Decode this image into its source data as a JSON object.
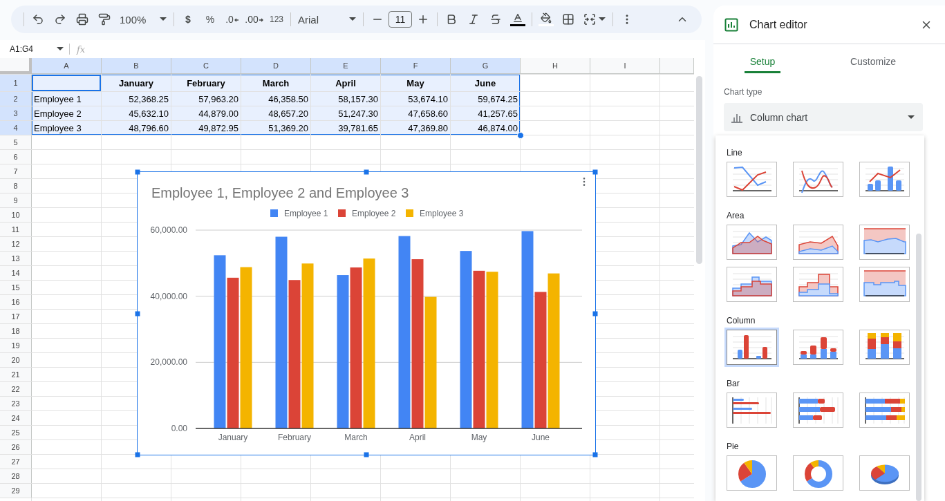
{
  "toolbar": {
    "zoom": "100%",
    "format_buttons": [
      {
        "kind": "currency",
        "label": "$"
      },
      {
        "kind": "percent",
        "label": "%"
      },
      {
        "kind": "decrease-decimal",
        "label": ".0"
      },
      {
        "kind": "increase-decimal",
        "label": ".00"
      },
      {
        "kind": "number-format",
        "label": "123"
      }
    ],
    "font": "Arial",
    "font_size": "11"
  },
  "formula_bar": {
    "name_box": "A1:G4",
    "function_label": "fx"
  },
  "sheet": {
    "columns": [
      {
        "label": "A",
        "selected": true
      },
      {
        "label": "B",
        "selected": true
      },
      {
        "label": "C",
        "selected": true
      },
      {
        "label": "D",
        "selected": true
      },
      {
        "label": "E",
        "selected": true
      },
      {
        "label": "F",
        "selected": true
      },
      {
        "label": "G",
        "selected": true
      },
      {
        "label": "H",
        "selected": false
      },
      {
        "label": "I",
        "selected": false
      }
    ],
    "rows": [
      {
        "number": "1",
        "selected": true,
        "cells": [
          {
            "kind": "blank",
            "active": true
          },
          {
            "kind": "heading",
            "text": "January",
            "active": false
          },
          {
            "kind": "heading",
            "text": "February",
            "active": false
          },
          {
            "kind": "heading",
            "text": "March",
            "active": false
          },
          {
            "kind": "heading",
            "text": "April",
            "active": false
          },
          {
            "kind": "heading",
            "text": "May",
            "active": false
          },
          {
            "kind": "heading",
            "text": "June",
            "active": false
          }
        ]
      },
      {
        "number": "2",
        "selected": true,
        "cells": [
          {
            "kind": "label",
            "text": "Employee 1",
            "active": false
          },
          {
            "kind": "number",
            "text": "52,368.25",
            "active": false
          },
          {
            "kind": "number",
            "text": "57,963.20",
            "active": false
          },
          {
            "kind": "number",
            "text": "46,358.50",
            "active": false
          },
          {
            "kind": "number",
            "text": "58,157.30",
            "active": false
          },
          {
            "kind": "number",
            "text": "53,674.10",
            "active": false
          },
          {
            "kind": "number",
            "text": "59,674.25",
            "active": false
          }
        ]
      },
      {
        "number": "3",
        "selected": true,
        "cells": [
          {
            "kind": "label",
            "text": "Employee 2",
            "active": false
          },
          {
            "kind": "number",
            "text": "45,632.10",
            "active": false
          },
          {
            "kind": "number",
            "text": "44,879.00",
            "active": false
          },
          {
            "kind": "number",
            "text": "48,657.20",
            "active": false
          },
          {
            "kind": "number",
            "text": "51,247.30",
            "active": false
          },
          {
            "kind": "number",
            "text": "47,658.60",
            "active": false
          },
          {
            "kind": "number",
            "text": "41,257.65",
            "active": false
          }
        ]
      },
      {
        "number": "4",
        "selected": true,
        "cells": [
          {
            "kind": "label",
            "text": "Employee 3",
            "active": false
          },
          {
            "kind": "number",
            "text": "48,796.60",
            "active": false
          },
          {
            "kind": "number",
            "text": "49,872.95",
            "active": false
          },
          {
            "kind": "number",
            "text": "51,369.20",
            "active": false
          },
          {
            "kind": "number",
            "text": "39,781.65",
            "active": false
          },
          {
            "kind": "number",
            "text": "47,369.80",
            "active": false
          },
          {
            "kind": "number",
            "text": "46,874.00",
            "active": false
          }
        ]
      },
      {
        "number": "5",
        "selected": false
      },
      {
        "number": "6",
        "selected": false
      },
      {
        "number": "7",
        "selected": false
      },
      {
        "number": "8",
        "selected": false
      },
      {
        "number": "9",
        "selected": false
      },
      {
        "number": "10",
        "selected": false
      },
      {
        "number": "11",
        "selected": false
      },
      {
        "number": "12",
        "selected": false
      },
      {
        "number": "13",
        "selected": false
      },
      {
        "number": "14",
        "selected": false
      },
      {
        "number": "15",
        "selected": false
      },
      {
        "number": "16",
        "selected": false
      },
      {
        "number": "17",
        "selected": false
      },
      {
        "number": "18",
        "selected": false
      },
      {
        "number": "19",
        "selected": false
      },
      {
        "number": "20",
        "selected": false
      },
      {
        "number": "21",
        "selected": false
      },
      {
        "number": "22",
        "selected": false
      },
      {
        "number": "23",
        "selected": false
      },
      {
        "number": "24",
        "selected": false
      },
      {
        "number": "25",
        "selected": false
      },
      {
        "number": "26",
        "selected": false
      },
      {
        "number": "27",
        "selected": false
      },
      {
        "number": "28",
        "selected": false
      },
      {
        "number": "29",
        "selected": false
      }
    ]
  },
  "chart": {
    "chart_data": {
      "type": "bar",
      "title": "Employee 1, Employee 2 and Employee 3",
      "categories": [
        "January",
        "February",
        "March",
        "April",
        "May",
        "June"
      ],
      "series": [
        {
          "name": "Employee 1",
          "color": "#4285f4",
          "values": [
            52400,
            58000,
            46400,
            58200,
            53700,
            59700
          ]
        },
        {
          "name": "Employee 2",
          "color": "#db4437",
          "values": [
            45600,
            44900,
            48700,
            51200,
            47700,
            41300
          ]
        },
        {
          "name": "Employee 3",
          "color": "#f4b400",
          "values": [
            48800,
            49900,
            51400,
            39800,
            47400,
            46900
          ]
        }
      ],
      "legend": "top",
      "ylim": [
        0,
        60000
      ],
      "yticks": [
        {
          "value": 0,
          "label": "0.00"
        },
        {
          "value": 20000,
          "label": "20,000.00"
        },
        {
          "value": 40000,
          "label": "40,000.00"
        },
        {
          "value": 60000,
          "label": "60,000.00"
        }
      ]
    }
  },
  "chart_editor": {
    "title": "Chart editor",
    "tabs": [
      {
        "label": "Setup",
        "selected": true
      },
      {
        "label": "Customize",
        "selected": false
      }
    ],
    "chart_type_label": "Chart type",
    "chart_type": "Column chart",
    "gallery": [
      {
        "label": "Line",
        "options": [
          {
            "kind": "line",
            "selected": false
          },
          {
            "kind": "smooth-line",
            "selected": false
          },
          {
            "kind": "combo",
            "selected": false
          }
        ]
      },
      {
        "label": "Area",
        "options": [
          {
            "kind": "area",
            "selected": false
          },
          {
            "kind": "stacked-area",
            "selected": false
          },
          {
            "kind": "full-area",
            "selected": false
          },
          {
            "kind": "stepped-area",
            "selected": false
          },
          {
            "kind": "stacked-stepped-area",
            "selected": false
          },
          {
            "kind": "full-stepped-area",
            "selected": false
          }
        ]
      },
      {
        "label": "Column",
        "options": [
          {
            "kind": "column",
            "selected": true
          },
          {
            "kind": "stacked-column",
            "selected": false
          },
          {
            "kind": "full-column",
            "selected": false
          }
        ]
      },
      {
        "label": "Bar",
        "options": [
          {
            "kind": "bar",
            "selected": false
          },
          {
            "kind": "stacked-bar",
            "selected": false
          },
          {
            "kind": "full-bar",
            "selected": false
          }
        ]
      },
      {
        "label": "Pie",
        "options": [
          {
            "kind": "pie",
            "selected": false
          },
          {
            "kind": "donut",
            "selected": false
          },
          {
            "kind": "pie-3d",
            "selected": false
          }
        ]
      }
    ]
  }
}
